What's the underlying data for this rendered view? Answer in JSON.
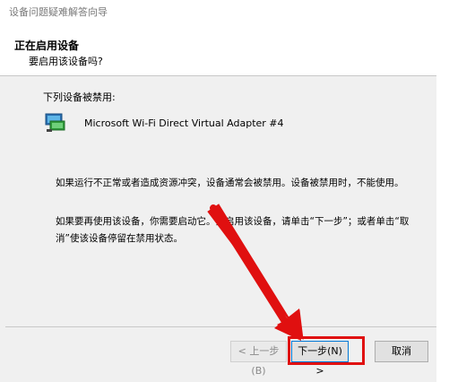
{
  "window": {
    "title": "设备问题疑难解答向导"
  },
  "header": {
    "title": "正在启用设备",
    "subtitle": "要启用该设备吗?"
  },
  "content": {
    "disabled_label": "下列设备被禁用:",
    "device_name": "Microsoft Wi-Fi Direct Virtual Adapter #4",
    "paragraph1": "如果运行不正常或者造成资源冲突，设备通常会被禁用。设备被禁用时，不能使用。",
    "paragraph2": "如果要再使用该设备，你需要启动它。要启用该设备，请单击“下一步”；或者单击“取消”使该设备停留在禁用状态。"
  },
  "footer": {
    "back_label": "< 上一步(B)",
    "next_label": "下一步(N) >",
    "cancel_label": "取消"
  },
  "colors": {
    "highlight": "#e01010",
    "accent": "#0078d7"
  }
}
